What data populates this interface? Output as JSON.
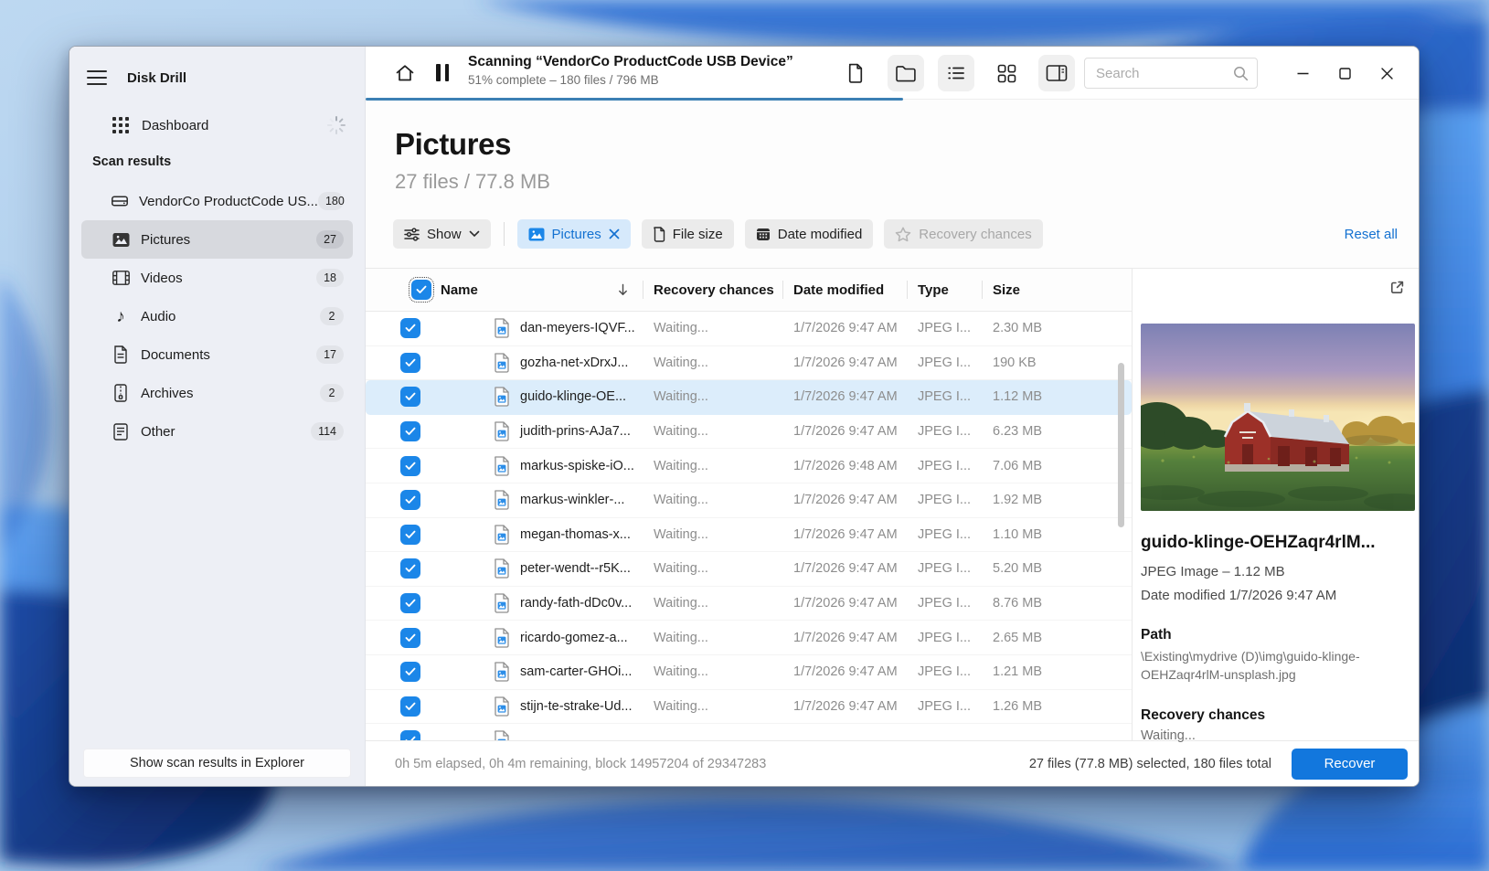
{
  "colors": {
    "accent": "#1371d1",
    "checkbox_blue": "#1b86e8",
    "progress_bar": "#3c80b4",
    "selected_row_bg": "#dcedfb",
    "sidebar_bg": "#edeff5"
  },
  "sidebar": {
    "app_title": "Disk Drill",
    "dashboard": {
      "label": "Dashboard",
      "icon": "dashboard-grid-icon",
      "spinner": "loading-spinner"
    },
    "section_label": "Scan results",
    "items": [
      {
        "label": "VendorCo ProductCode US...",
        "count": "180",
        "icon": "drive-icon",
        "selected": false
      },
      {
        "label": "Pictures",
        "count": "27",
        "icon": "pictures-icon",
        "selected": true
      },
      {
        "label": "Videos",
        "count": "18",
        "icon": "videos-icon",
        "selected": false
      },
      {
        "label": "Audio",
        "count": "2",
        "icon": "audio-icon",
        "selected": false
      },
      {
        "label": "Documents",
        "count": "17",
        "icon": "documents-icon",
        "selected": false
      },
      {
        "label": "Archives",
        "count": "2",
        "icon": "archives-icon",
        "selected": false
      },
      {
        "label": "Other",
        "count": "114",
        "icon": "other-icon",
        "selected": false
      }
    ],
    "footer_button": "Show scan results in Explorer"
  },
  "toolbar": {
    "scan_title": "Scanning “VendorCo ProductCode USB Device”",
    "scan_subtitle": "51% complete – 180 files / 796 MB",
    "progress_percent": 51,
    "search_placeholder": "Search",
    "icons": [
      "home-icon",
      "pause-icon",
      "file-view-icon",
      "folder-view-icon",
      "list-view-icon",
      "grid-view-icon",
      "panel-view-icon"
    ]
  },
  "page": {
    "title": "Pictures",
    "subtitle": "27 files / 77.8 MB"
  },
  "filters": {
    "show_label": "Show",
    "chips": [
      {
        "label": "Pictures",
        "state": "active",
        "icon": "image-icon",
        "closable": true
      },
      {
        "label": "File size",
        "state": "normal",
        "icon": "file-icon"
      },
      {
        "label": "Date modified",
        "state": "normal",
        "icon": "calendar-icon"
      },
      {
        "label": "Recovery chances",
        "state": "disabled",
        "icon": "star-icon"
      }
    ],
    "reset_all": "Reset all"
  },
  "table": {
    "columns": [
      "Name",
      "Recovery chances",
      "Date modified",
      "Type",
      "Size"
    ],
    "rows": [
      {
        "name": "dan-meyers-IQVF...",
        "recovery": "Waiting...",
        "date": "1/7/2026 9:47 AM",
        "type": "JPEG I...",
        "size": "2.30 MB"
      },
      {
        "name": "gozha-net-xDrxJ...",
        "recovery": "Waiting...",
        "date": "1/7/2026 9:47 AM",
        "type": "JPEG I...",
        "size": "190 KB"
      },
      {
        "name": "guido-klinge-OE...",
        "recovery": "Waiting...",
        "date": "1/7/2026 9:47 AM",
        "type": "JPEG I...",
        "size": "1.12 MB"
      },
      {
        "name": "judith-prins-AJa7...",
        "recovery": "Waiting...",
        "date": "1/7/2026 9:47 AM",
        "type": "JPEG I...",
        "size": "6.23 MB"
      },
      {
        "name": "markus-spiske-iO...",
        "recovery": "Waiting...",
        "date": "1/7/2026 9:48 AM",
        "type": "JPEG I...",
        "size": "7.06 MB"
      },
      {
        "name": "markus-winkler-...",
        "recovery": "Waiting...",
        "date": "1/7/2026 9:47 AM",
        "type": "JPEG I...",
        "size": "1.92 MB"
      },
      {
        "name": "megan-thomas-x...",
        "recovery": "Waiting...",
        "date": "1/7/2026 9:47 AM",
        "type": "JPEG I...",
        "size": "1.10 MB"
      },
      {
        "name": "peter-wendt--r5K...",
        "recovery": "Waiting...",
        "date": "1/7/2026 9:47 AM",
        "type": "JPEG I...",
        "size": "5.20 MB"
      },
      {
        "name": "randy-fath-dDc0v...",
        "recovery": "Waiting...",
        "date": "1/7/2026 9:47 AM",
        "type": "JPEG I...",
        "size": "8.76 MB"
      },
      {
        "name": "ricardo-gomez-a...",
        "recovery": "Waiting...",
        "date": "1/7/2026 9:47 AM",
        "type": "JPEG I...",
        "size": "2.65 MB"
      },
      {
        "name": "sam-carter-GHOi...",
        "recovery": "Waiting...",
        "date": "1/7/2026 9:47 AM",
        "type": "JPEG I...",
        "size": "1.21 MB"
      },
      {
        "name": "stijn-te-strake-Ud...",
        "recovery": "Waiting...",
        "date": "1/7/2026 9:47 AM",
        "type": "JPEG I...",
        "size": "1.26 MB"
      }
    ],
    "selected_row_index": 2
  },
  "preview": {
    "filename": "guido-klinge-OEHZaqr4rlM...",
    "meta": "JPEG Image – 1.12 MB",
    "date_modified": "Date modified 1/7/2026 9:47 AM",
    "path_label": "Path",
    "path_value": "\\Existing\\mydrive (D)\\img\\guido-klinge-OEHZaqr4rlM-unsplash.jpg",
    "recovery_label": "Recovery chances",
    "recovery_value": "Waiting..."
  },
  "statusbar": {
    "left": "0h 5m elapsed, 0h 4m remaining, block 14957204 of 29347283",
    "right": "27 files (77.8 MB) selected, 180 files total",
    "recover_button": "Recover"
  }
}
